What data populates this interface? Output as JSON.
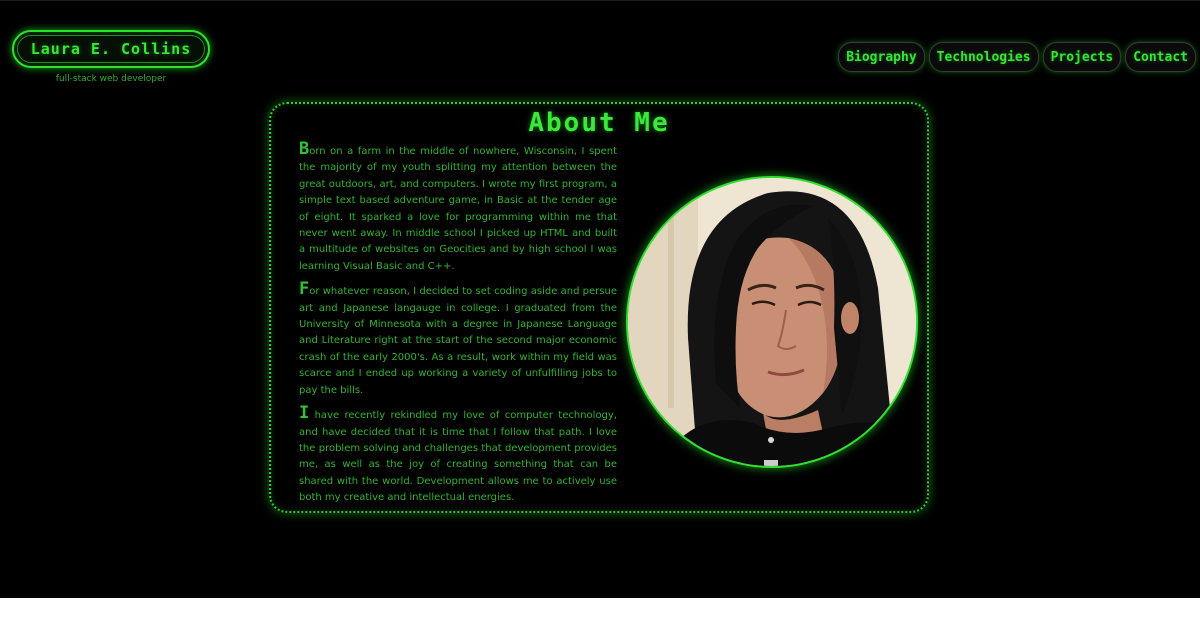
{
  "header": {
    "logo_name": "Laura E. Collins",
    "tagline": "full-stack web developer"
  },
  "nav": {
    "items": [
      {
        "label": "Biography"
      },
      {
        "label": "Technologies"
      },
      {
        "label": "Projects"
      },
      {
        "label": "Contact"
      }
    ]
  },
  "about": {
    "title": "About Me",
    "paragraphs": [
      {
        "initial": "B",
        "rest": "orn on a farm in the middle of nowhere, Wisconsin, I spent the majority of my youth splitting my attention between the great outdoors, art, and computers. I wrote my first program, a simple text based adventure game, in Basic at the tender age of eight. It sparked a love for programming within me that never went away. In middle school I picked up HTML and built a multitude of websites on Geocities and by high school I was learning Visual Basic and C++."
      },
      {
        "initial": "F",
        "rest": "or whatever reason, I decided to set coding aside and persue art and Japanese langauge in college. I graduated from the University of Minnesota with a degree in Japanese Language and Literature right at the start of the second major economic crash of the early 2000's. As a result, work within my field was scarce and I ended up working a variety of unfulfilling jobs to pay the bills."
      },
      {
        "initial": "I",
        "rest": " have recently rekindled my love of computer technology, and have decided that it is time that I follow that path. I love the problem solving and challenges that development provides me, as well as the joy of creating something that can be shared with the world. Development allows me to actively use both my creative and intellectual energies."
      }
    ],
    "portrait_icon": "profile-photo"
  },
  "colors": {
    "accent": "#37e637",
    "text": "#2fb42f",
    "background": "#000000"
  }
}
